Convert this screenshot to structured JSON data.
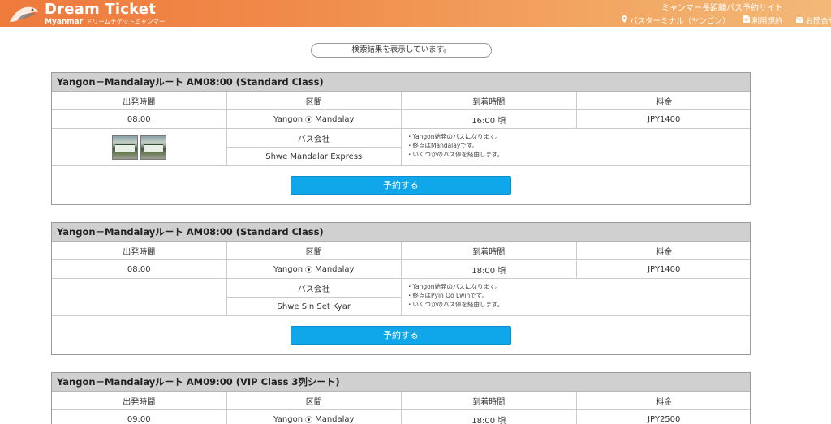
{
  "header": {
    "logo_title": "Dream Ticket",
    "logo_sub_strong": "Myanmar",
    "logo_sub": "ドリームチケットミャンマー",
    "site_caption": "ミャンマー長距離バス予約サイト",
    "links": [
      {
        "label": "バスターミナル（ヤンゴン）",
        "icon": "pin-icon"
      },
      {
        "label": "利用規約",
        "icon": "document-icon"
      },
      {
        "label": "お問合せ",
        "icon": "mail-icon"
      }
    ]
  },
  "search_status": "検索結果を表示しています。",
  "columns": [
    "出発時間",
    "区間",
    "到着時間",
    "料金"
  ],
  "results": [
    {
      "title": "Yangon－Mandalayルート AM08:00 (Standard Class)",
      "depart": "08:00",
      "from": "Yangon",
      "to": "Mandalay",
      "arrive": "16:00 頃",
      "fare": "JPY1400",
      "company_label": "バス会社",
      "company": "Shwe Mandalar Express",
      "notes": [
        "・Yangon始発のバスになります。",
        "・終点はMandalayです。",
        "・いくつかのバス停を経由します。"
      ],
      "book_label": "予約する",
      "has_photos": true
    },
    {
      "title": "Yangon－Mandalayルート AM08:00 (Standard Class)",
      "depart": "08:00",
      "from": "Yangon",
      "to": "Mandalay",
      "arrive": "18:00 頃",
      "fare": "JPY1400",
      "company_label": "バス会社",
      "company": "Shwe Sin Set Kyar",
      "notes": [
        "・Yangon始発のバスになります。",
        "・終点はPyin Oo Lwinです。",
        "・いくつかのバス停を経由します。"
      ],
      "book_label": "予約する",
      "has_photos": false
    },
    {
      "title": "Yangon－Mandalayルート AM09:00 (VIP Class 3列シート)",
      "depart": "09:00",
      "from": "Yangon",
      "to": "Mandalay",
      "arrive": "18:00 頃",
      "fare": "JPY2500"
    }
  ],
  "colors": {
    "header_start": "#ee7a3c",
    "header_end": "#f3b877",
    "button": "#10a6ea",
    "title_bar": "#d0d0d0"
  }
}
